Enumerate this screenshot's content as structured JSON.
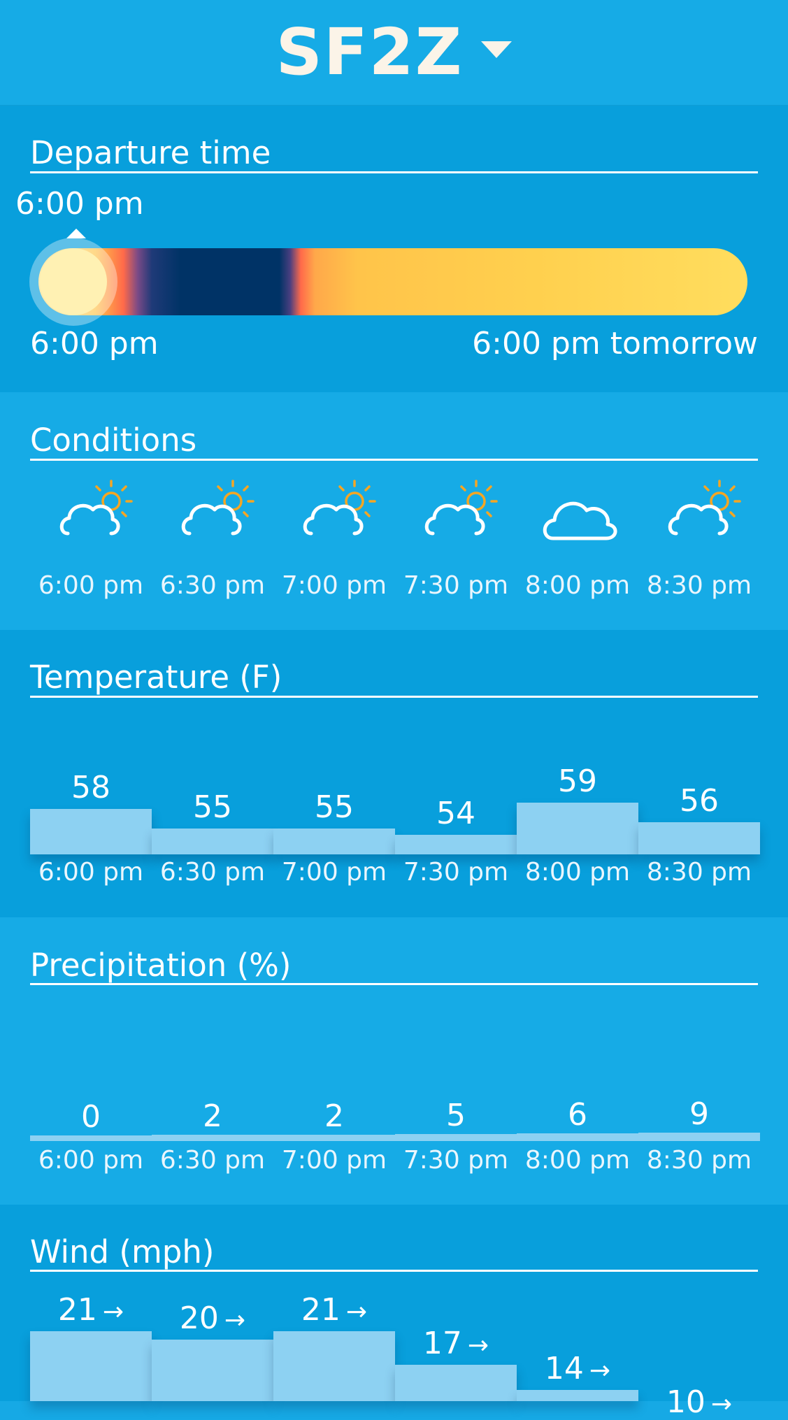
{
  "header": {
    "title": "SF2Z",
    "dropdown_icon": "caret-down-icon"
  },
  "departure": {
    "title": "Departure time",
    "selected_time": "6:00 pm",
    "range_start": "6:00 pm",
    "range_end": "6:00 pm tomorrow",
    "slider_position": 0.0
  },
  "conditions": {
    "title": "Conditions",
    "items": [
      {
        "time": "6:00 pm",
        "icon": "partly-cloudy-icon"
      },
      {
        "time": "6:30 pm",
        "icon": "partly-cloudy-icon"
      },
      {
        "time": "7:00 pm",
        "icon": "partly-cloudy-icon"
      },
      {
        "time": "7:30 pm",
        "icon": "partly-cloudy-icon"
      },
      {
        "time": "8:00 pm",
        "icon": "cloud-icon"
      },
      {
        "time": "8:30 pm",
        "icon": "partly-cloudy-icon"
      }
    ]
  },
  "temperature": {
    "title": "Temperature (F)",
    "times": [
      "6:00 pm",
      "6:30 pm",
      "7:00 pm",
      "7:30 pm",
      "8:00 pm",
      "8:30 pm"
    ],
    "values": [
      58,
      55,
      55,
      54,
      59,
      56
    ],
    "value_labels": [
      "58",
      "55",
      "55",
      "54",
      "59",
      "56"
    ]
  },
  "precipitation": {
    "title": "Precipitation (%)",
    "times": [
      "6:00 pm",
      "6:30 pm",
      "7:00 pm",
      "7:30 pm",
      "8:00 pm",
      "8:30 pm"
    ],
    "values": [
      0,
      2,
      2,
      5,
      6,
      9
    ],
    "value_labels": [
      "0",
      "2",
      "2",
      "5",
      "6",
      "9"
    ]
  },
  "wind": {
    "title": "Wind (mph)",
    "values": [
      21,
      20,
      21,
      17,
      14,
      10
    ],
    "value_labels": [
      "21",
      "20",
      "21",
      "17",
      "14",
      "10"
    ],
    "arrow": "→"
  },
  "colors": {
    "background": "#16abe6",
    "section_dark": "#089fdc",
    "bar": "#8dd1f2",
    "sun": "#f5a623",
    "title": "#fbf4e8"
  }
}
